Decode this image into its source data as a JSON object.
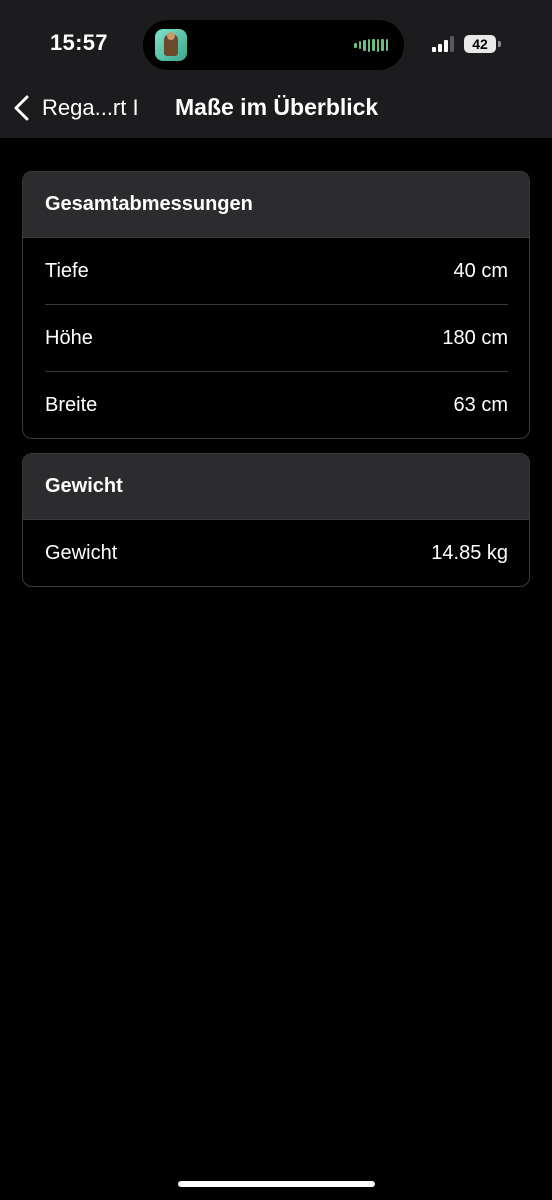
{
  "status_bar": {
    "time": "15:57",
    "battery": "42"
  },
  "nav": {
    "back_label": "Rega...rt I",
    "title": "Maße im Überblick"
  },
  "sections": [
    {
      "title": "Gesamtabmessungen",
      "rows": [
        {
          "label": "Tiefe",
          "value": "40 cm"
        },
        {
          "label": "Höhe",
          "value": "180 cm"
        },
        {
          "label": "Breite",
          "value": "63 cm"
        }
      ]
    },
    {
      "title": "Gewicht",
      "rows": [
        {
          "label": "Gewicht",
          "value": "14.85 kg"
        }
      ]
    }
  ],
  "icons": {
    "back": "chevron-left-icon",
    "island_app": "app-icon",
    "wave": "audio-wave-icon",
    "signal": "cellular-signal-icon",
    "battery": "battery-icon"
  },
  "colors": {
    "background": "#000000",
    "header": "#1c1c1e",
    "card_header": "#2c2c2e",
    "divider": "#3a3a3c",
    "text": "#ffffff"
  }
}
